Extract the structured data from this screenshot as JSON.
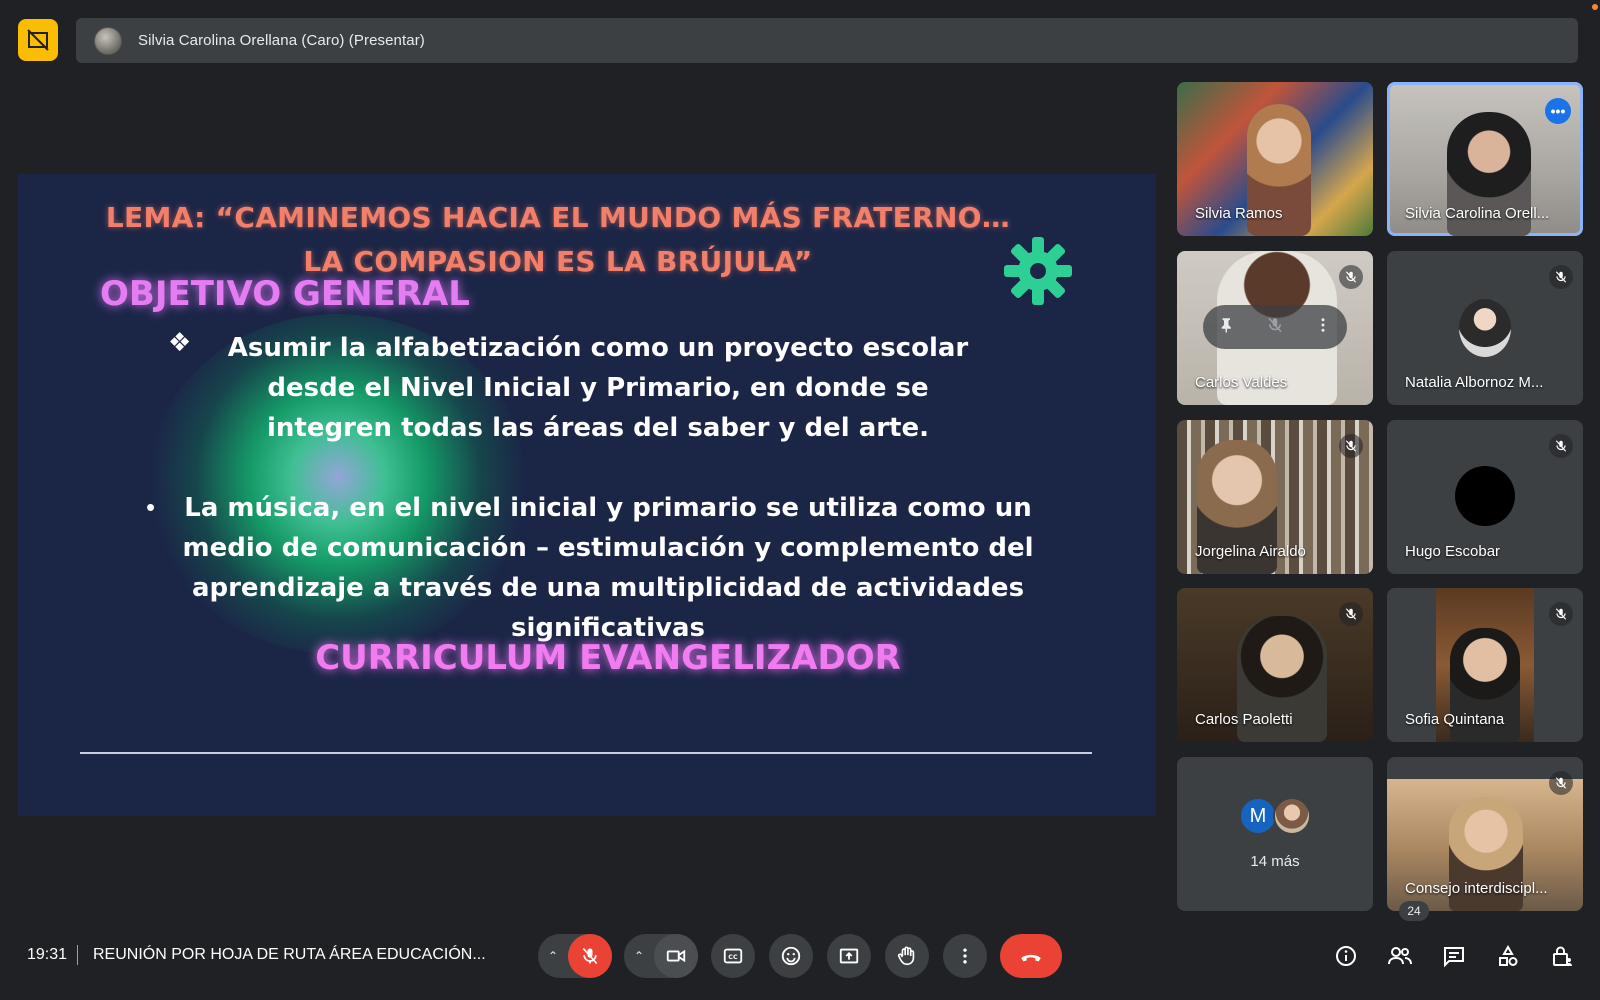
{
  "header": {
    "presenter_label": "Silvia Carolina Orellana (Caro) (Presentar)",
    "icons": {
      "logo": "screen-share-off-icon",
      "avatar": "presenter-avatar"
    }
  },
  "slide": {
    "lema": "LEMA: “CAMINEMOS HACIA EL MUNDO MÁS FRATERNO…LA COMPASION ES LA BRÚJULA”",
    "objetivo": "OBJETIVO GENERAL",
    "bullet_1": "Asumir la alfabetización como un proyecto escolar desde el Nivel Inicial y Primario, en donde se integren todas las áreas del saber y del arte.",
    "bullet_2": "La música, en el nivel inicial y primario se utiliza como un medio de comunicación – estimulación y complemento del aprendizaje a través de una multiplicidad de actividades significativas",
    "curriculum": "CURRICULUM EVANGELIZADOR",
    "colors": {
      "background": "#1b2647",
      "lema": "#f27f6a",
      "heading": "#e57cf2",
      "gear": "#2ecf94"
    }
  },
  "participants": [
    {
      "name": "Silvia Ramos",
      "muted": false
    },
    {
      "name": "Silvia Carolina Orell...",
      "muted": false,
      "active": true
    },
    {
      "name": "Carlos Valdes",
      "muted": true
    },
    {
      "name": "Natalia Albornoz M...",
      "muted": true
    },
    {
      "name": "Jorgelina Airaldo",
      "muted": true
    },
    {
      "name": "Hugo Escobar",
      "muted": true
    },
    {
      "name": "Carlos Paoletti",
      "muted": true
    },
    {
      "name": "Sofia Quintana",
      "muted": true
    },
    {
      "name": "Consejo interdiscipl...",
      "muted": true
    }
  ],
  "more_tile": {
    "initial": "M",
    "label": "14 más"
  },
  "bottom_bar": {
    "time": "19:31",
    "separator": "|",
    "meeting_title": "REUNIÓN POR HOJA DE RUTA ÁREA EDUCACIÓN...",
    "participants_count": "24",
    "caret": "^"
  },
  "colors": {
    "accent": "#8ab4f8",
    "danger": "#ea4335",
    "surface": "#3c4043",
    "background": "#202124"
  }
}
